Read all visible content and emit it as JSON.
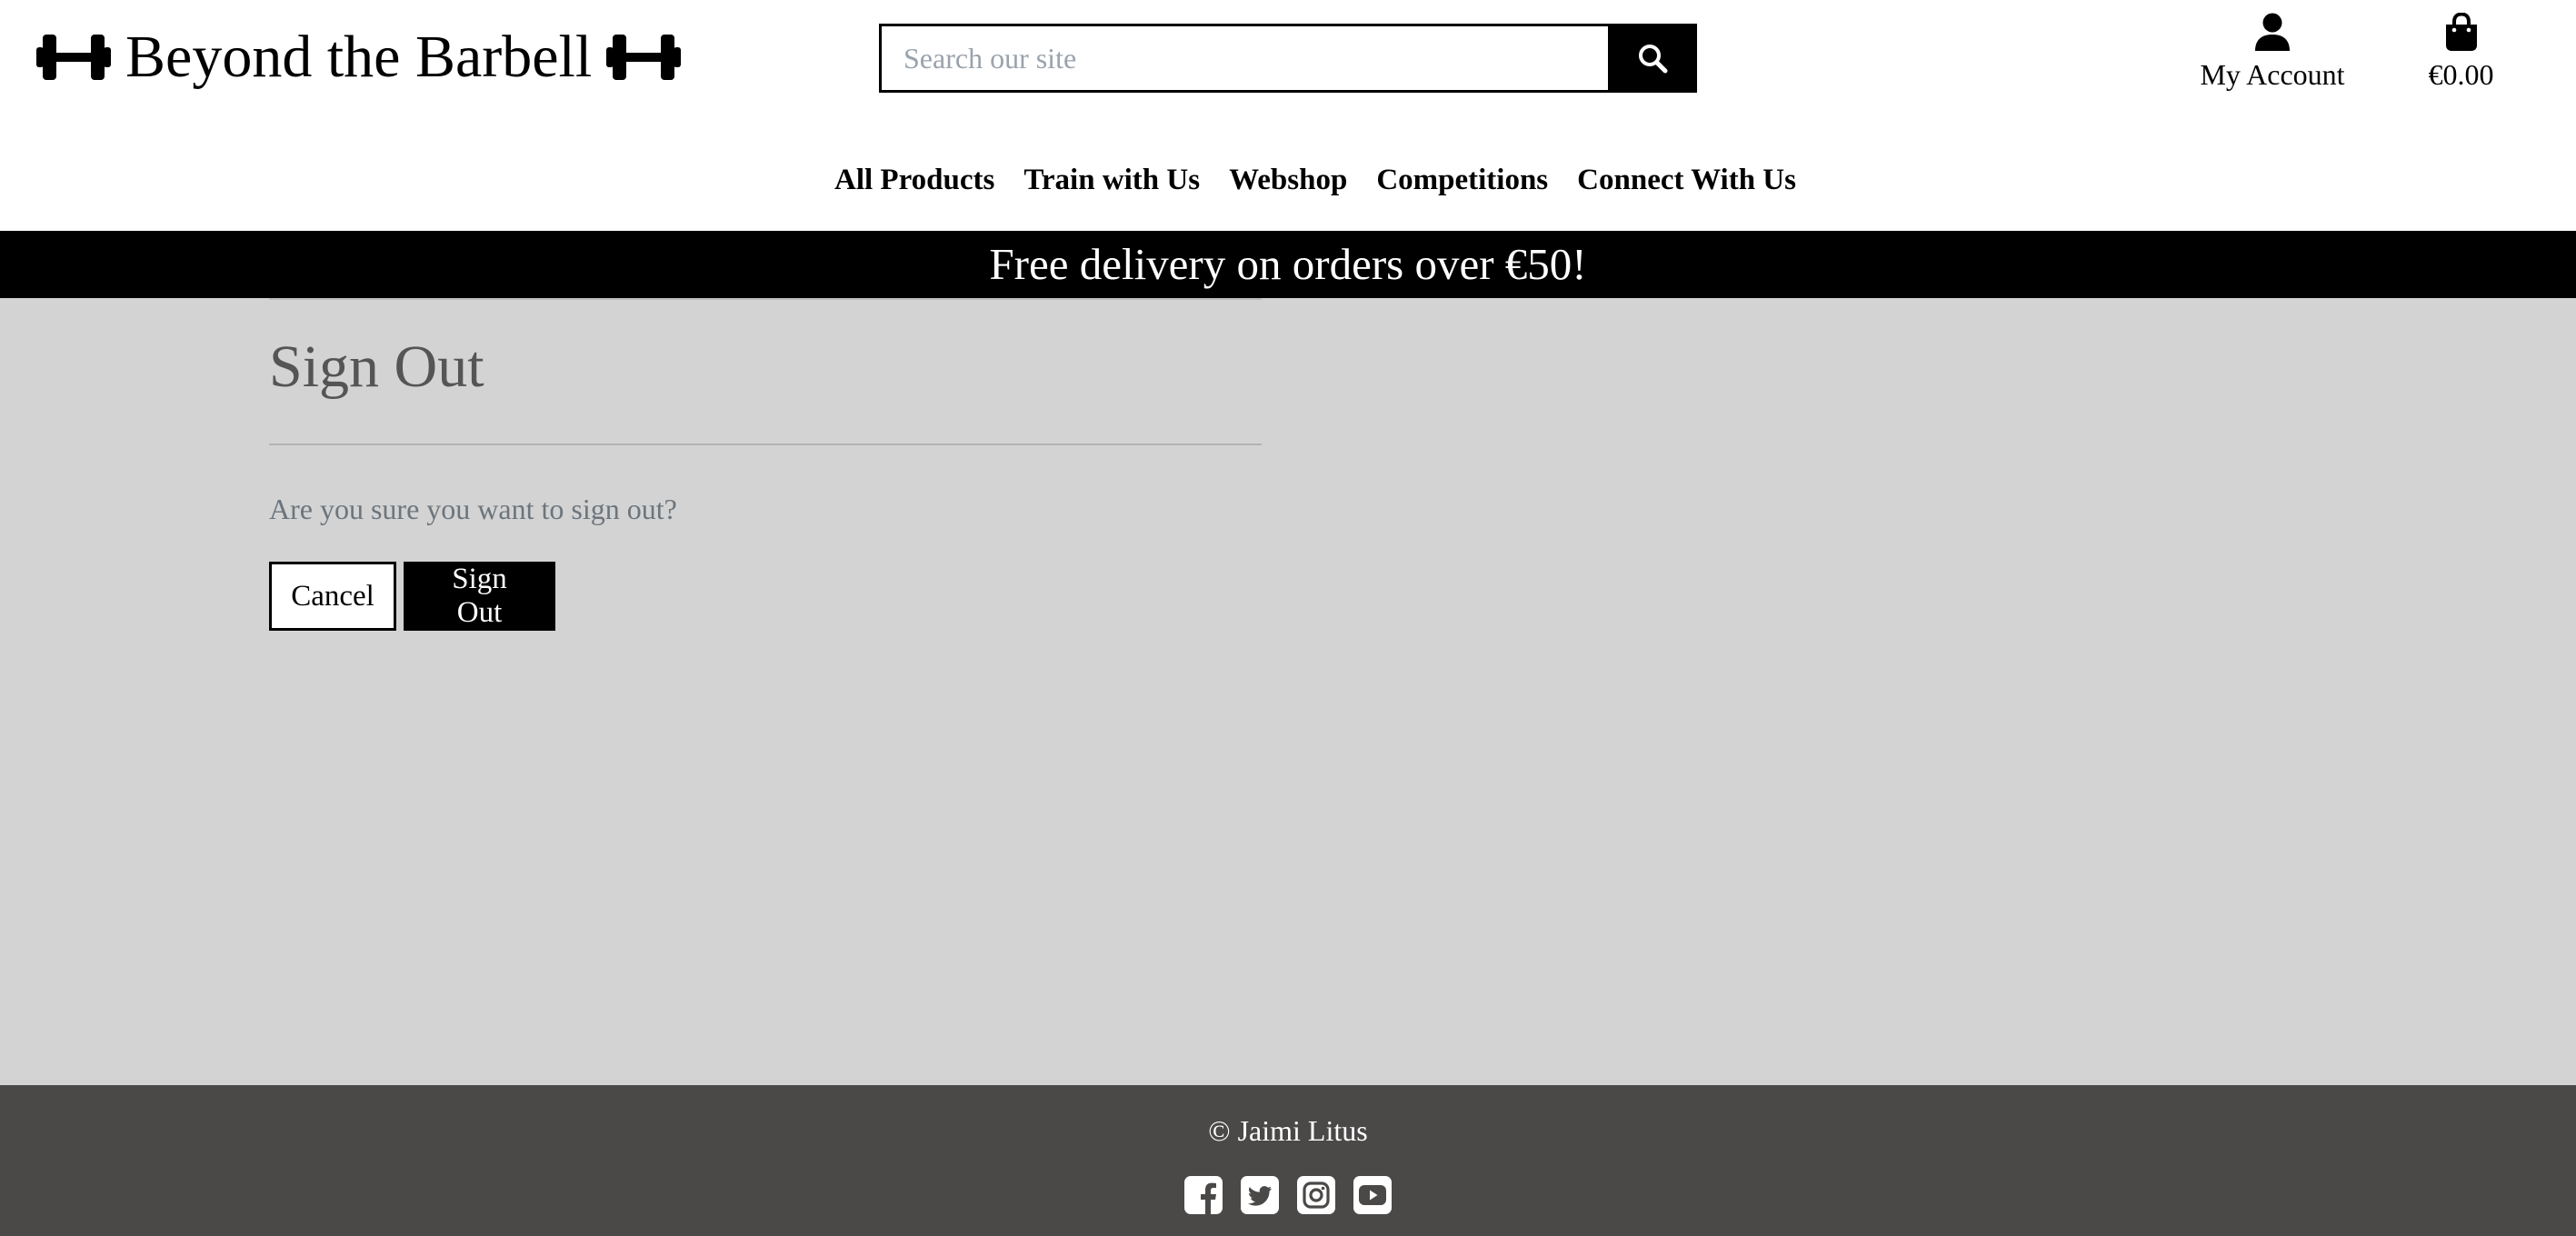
{
  "header": {
    "logo_text": "Beyond the Barbell",
    "search": {
      "placeholder": "Search our site"
    },
    "account_label": "My Account",
    "bag_total": "€0.00"
  },
  "nav": {
    "items": [
      {
        "label": "All Products"
      },
      {
        "label": "Train with Us"
      },
      {
        "label": "Webshop"
      },
      {
        "label": "Competitions"
      },
      {
        "label": "Connect With Us"
      }
    ]
  },
  "banner": {
    "text": "Free delivery on orders over €50!"
  },
  "main": {
    "title": "Sign Out",
    "message": "Are you sure you want to sign out?",
    "cancel_label": "Cancel",
    "signout_label": "Sign Out"
  },
  "footer": {
    "copyright": "© Jaimi Litus",
    "socials": [
      "facebook-icon",
      "twitter-icon",
      "instagram-icon",
      "youtube-icon"
    ]
  },
  "colors": {
    "page_bg": "#d3d3d3",
    "footer_bg": "#4a4948",
    "banner_bg": "#000000",
    "title_text": "#555555",
    "muted_text": "#6c757d"
  }
}
